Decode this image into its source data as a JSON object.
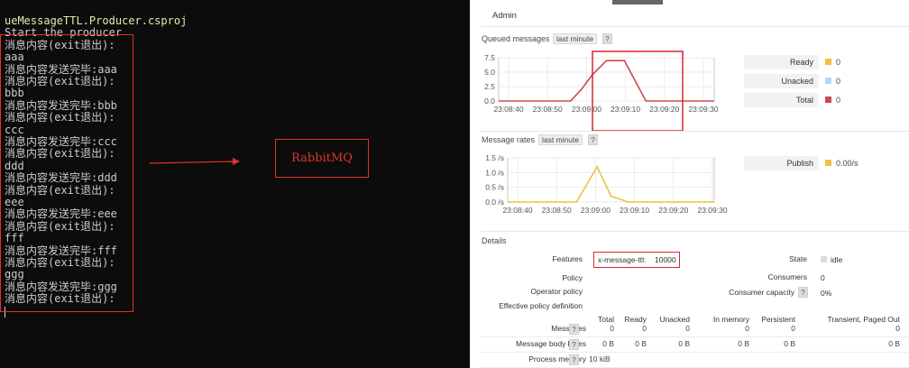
{
  "console": {
    "lines": [
      {
        "text": "ueMessageTTL.Producer.csproj",
        "style": "yellow"
      },
      {
        "text": "Start the producer",
        "style": "normal"
      },
      {
        "text": "消息内容(exit退出):",
        "style": "normal"
      },
      {
        "text": "aaa",
        "style": "normal"
      },
      {
        "text": "消息内容发送完毕:aaa",
        "style": "normal"
      },
      {
        "text": "消息内容(exit退出):",
        "style": "normal"
      },
      {
        "text": "bbb",
        "style": "normal"
      },
      {
        "text": "消息内容发送完毕:bbb",
        "style": "normal"
      },
      {
        "text": "消息内容(exit退出):",
        "style": "normal"
      },
      {
        "text": "ccc",
        "style": "normal"
      },
      {
        "text": "消息内容发送完毕:ccc",
        "style": "normal"
      },
      {
        "text": "消息内容(exit退出):",
        "style": "normal"
      },
      {
        "text": "ddd",
        "style": "normal"
      },
      {
        "text": "消息内容发送完毕:ddd",
        "style": "normal"
      },
      {
        "text": "消息内容(exit退出):",
        "style": "normal"
      },
      {
        "text": "eee",
        "style": "normal"
      },
      {
        "text": "消息内容发送完毕:eee",
        "style": "normal"
      },
      {
        "text": "消息内容(exit退出):",
        "style": "normal"
      },
      {
        "text": "fff",
        "style": "normal"
      },
      {
        "text": "消息内容发送完毕:fff",
        "style": "normal"
      },
      {
        "text": "消息内容(exit退出):",
        "style": "normal"
      },
      {
        "text": "ggg",
        "style": "normal"
      },
      {
        "text": "消息内容发送完毕:ggg",
        "style": "normal"
      },
      {
        "text": "消息内容(exit退出):",
        "style": "normal"
      }
    ],
    "annotation_label": "RabbitMQ",
    "annotation_color": "#e0332f"
  },
  "panel": {
    "admin_tab": "Admin",
    "queued": {
      "title": "Queued messages",
      "range": "last minute",
      "help": "?",
      "legend": [
        {
          "label": "Ready",
          "value": "0",
          "color": "#edc240"
        },
        {
          "label": "Unacked",
          "value": "0",
          "color": "#afd8f8"
        },
        {
          "label": "Total",
          "value": "0",
          "color": "#cb4b4b"
        }
      ]
    },
    "rates": {
      "title": "Message rates",
      "range": "last minute",
      "help": "?",
      "legend": [
        {
          "label": "Publish",
          "value": "0.00/s",
          "color": "#edc240"
        }
      ]
    },
    "details": {
      "title": "Details",
      "features_label": "Features",
      "features_key": "x-message-ttl:",
      "features_value": "10000",
      "policy_label": "Policy",
      "operator_policy_label": "Operator policy",
      "effective_policy_label": "Effective policy definition",
      "state_label": "State",
      "state_value": "idle",
      "consumers_label": "Consumers",
      "consumers_value": "0",
      "capacity_label": "Consumer capacity",
      "capacity_help": "?",
      "capacity_value": "0%"
    },
    "table": {
      "headers": [
        "Total",
        "Ready",
        "Unacked",
        "In memory",
        "Persistent",
        "Transient, Paged Out"
      ],
      "rows": [
        {
          "label": "Messages",
          "help": "?",
          "cells": [
            "0",
            "0",
            "0",
            "0",
            "0",
            "0"
          ]
        },
        {
          "label": "Message body bytes",
          "help": "?",
          "cells": [
            "0 B",
            "0 B",
            "0 B",
            "0 B",
            "0 B",
            "0 B"
          ]
        },
        {
          "label": "Process memory",
          "help": "?",
          "cells": [
            "10 kiB"
          ]
        }
      ]
    }
  },
  "chart_data": [
    {
      "type": "line",
      "title": "Queued messages",
      "x": [
        "23:08:40",
        "23:08:50",
        "23:09:00",
        "23:09:10",
        "23:09:20",
        "23:09:30"
      ],
      "ylim": [
        0,
        7.5
      ],
      "yticks": [
        "0.0",
        "2.5",
        "5.0",
        "7.5"
      ],
      "series": [
        {
          "name": "Total",
          "color": "#cb4b4b",
          "points": [
            [
              0,
              0
            ],
            [
              20,
              0
            ],
            [
              23,
              2
            ],
            [
              26,
              4.5
            ],
            [
              30,
              7
            ],
            [
              35,
              7
            ],
            [
              41,
              0
            ],
            [
              60,
              0
            ]
          ]
        }
      ]
    },
    {
      "type": "line",
      "title": "Message rates",
      "x": [
        "23:08:40",
        "23:08:50",
        "23:09:00",
        "23:09:10",
        "23:09:20",
        "23:09:30"
      ],
      "ylim": [
        0,
        1.5
      ],
      "yticks": [
        "0.0 /s",
        "0.5 /s",
        "1.0 /s",
        "1.5 /s"
      ],
      "series": [
        {
          "name": "Publish",
          "color": "#edc240",
          "points": [
            [
              0,
              0
            ],
            [
              20,
              0
            ],
            [
              26,
              1.2
            ],
            [
              30,
              0.2
            ],
            [
              35,
              0
            ],
            [
              60,
              0
            ]
          ]
        }
      ]
    }
  ]
}
